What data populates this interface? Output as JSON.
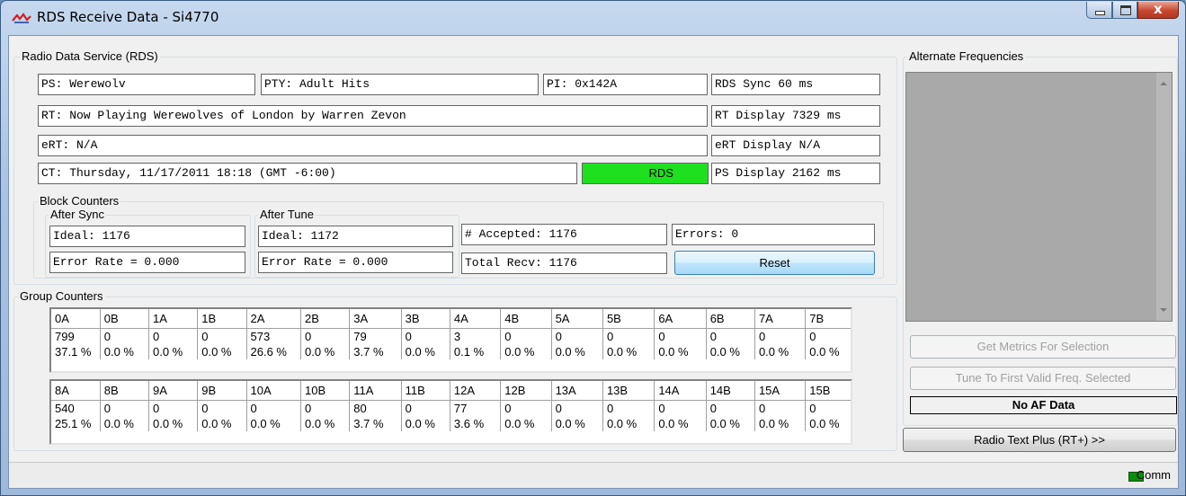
{
  "window": {
    "title": "RDS Receive Data - Si4770"
  },
  "rds": {
    "legend": "Radio Data Service (RDS)",
    "ps": "PS: Werewolv",
    "pty": "PTY: Adult Hits",
    "pi": "PI: 0x142A",
    "rds_sync": "RDS Sync 60 ms",
    "rt": "RT: Now Playing Werewolves of London by Warren Zevon",
    "rt_display": "RT Display 7329 ms",
    "ert": "eRT: N/A",
    "ert_display": "eRT Display N/A",
    "ct": "CT: Thursday, 11/17/2011 18:18 (GMT -6:00)",
    "rds_indicator": "RDS",
    "ps_display": "PS Display 2162 ms"
  },
  "block_counters": {
    "legend": "Block Counters",
    "after_sync": {
      "legend": "After Sync",
      "ideal": "Ideal: 1176",
      "error_rate": "Error Rate = 0.000"
    },
    "after_tune": {
      "legend": "After Tune",
      "ideal": "Ideal: 1172",
      "error_rate": "Error Rate = 0.000"
    },
    "accepted": "# Accepted: 1176",
    "errors": "Errors: 0",
    "total_recv": "Total Recv: 1176",
    "reset_label": "Reset"
  },
  "group_counters": {
    "legend": "Group Counters",
    "tables": [
      {
        "headers": [
          "0A",
          "0B",
          "1A",
          "1B",
          "2A",
          "2B",
          "3A",
          "3B",
          "4A",
          "4B",
          "5A",
          "5B",
          "6A",
          "6B",
          "7A",
          "7B"
        ],
        "counts": [
          "799",
          "0",
          "0",
          "0",
          "573",
          "0",
          "79",
          "0",
          "3",
          "0",
          "0",
          "0",
          "0",
          "0",
          "0",
          "0"
        ],
        "percents": [
          "37.1 %",
          "0.0 %",
          "0.0 %",
          "0.0 %",
          "26.6 %",
          "0.0 %",
          "3.7 %",
          "0.0 %",
          "0.1 %",
          "0.0 %",
          "0.0 %",
          "0.0 %",
          "0.0 %",
          "0.0 %",
          "0.0 %",
          "0.0 %"
        ]
      },
      {
        "headers": [
          "8A",
          "8B",
          "9A",
          "9B",
          "10A",
          "10B",
          "11A",
          "11B",
          "12A",
          "12B",
          "13A",
          "13B",
          "14A",
          "14B",
          "15A",
          "15B"
        ],
        "counts": [
          "540",
          "0",
          "0",
          "0",
          "0",
          "0",
          "80",
          "0",
          "77",
          "0",
          "0",
          "0",
          "0",
          "0",
          "0",
          "0"
        ],
        "percents": [
          "25.1 %",
          "0.0 %",
          "0.0 %",
          "0.0 %",
          "0.0 %",
          "0.0 %",
          "3.7 %",
          "0.0 %",
          "3.6 %",
          "0.0 %",
          "0.0 %",
          "0.0 %",
          "0.0 %",
          "0.0 %",
          "0.0 %",
          "0.0 %"
        ]
      }
    ]
  },
  "af": {
    "legend": "Alternate Frequencies",
    "get_metrics_label": "Get Metrics For Selection",
    "tune_first_label": "Tune To First Valid Freq. Selected",
    "status": "No AF Data",
    "rtplus_label": "Radio Text Plus (RT+)  >>"
  },
  "statusbar": {
    "comm_label": "Comm"
  },
  "colors": {
    "rds_indicator": "#1ee01e",
    "comm_led": "#0b8d0b"
  }
}
